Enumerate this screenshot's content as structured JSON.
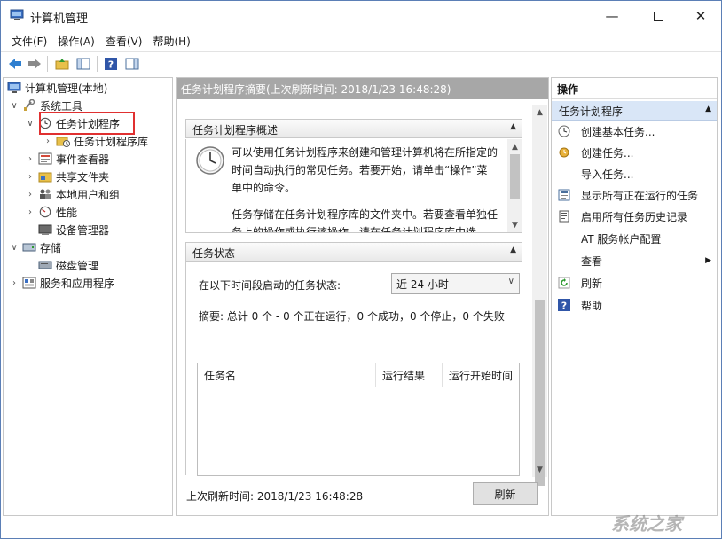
{
  "window": {
    "title": "计算机管理"
  },
  "menu": [
    "文件(F)",
    "操作(A)",
    "查看(V)",
    "帮助(H)"
  ],
  "tree": {
    "root": "计算机管理(本地)",
    "system_tools": "系统工具",
    "task_scheduler": "任务计划程序",
    "task_scheduler_library": "任务计划程序库",
    "event_viewer": "事件查看器",
    "shared_folders": "共享文件夹",
    "local_users_groups": "本地用户和组",
    "performance": "性能",
    "device_manager": "设备管理器",
    "storage": "存储",
    "disk_management": "磁盘管理",
    "services_apps": "服务和应用程序"
  },
  "center": {
    "summary_header": "任务计划程序摘要(上次刷新时间: 2018/1/23 16:48:28)",
    "overview_title": "任务计划程序概述",
    "overview_p1": "可以使用任务计划程序来创建和管理计算机将在所指定的时间自动执行的常见任务。若要开始，请单击“操作”菜单中的命令。",
    "overview_p2": "任务存储在任务计划程序库的文件夹中。若要查看单独任务上的操作或执行该操作，请在任务计划程序库中选",
    "status_title": "任务状态",
    "status_label": "在以下时间段启动的任务状态:",
    "period_selected": "近 24 小时",
    "summary_line": "摘要: 总计 0 个 - 0 个正在运行，0 个成功，0 个停止，0 个失败",
    "table_headers": [
      "任务名",
      "运行结果",
      "运行开始时间"
    ],
    "last_refresh": "上次刷新时间: 2018/1/23 16:48:28",
    "refresh_button": "刷新"
  },
  "actions": {
    "header": "操作",
    "subheader": "任务计划程序",
    "items": [
      "创建基本任务...",
      "创建任务...",
      "导入任务...",
      "显示所有正在运行的任务",
      "启用所有任务历史记录",
      "AT 服务帐户配置",
      "查看",
      "刷新",
      "帮助"
    ]
  },
  "watermark": "系统之家"
}
